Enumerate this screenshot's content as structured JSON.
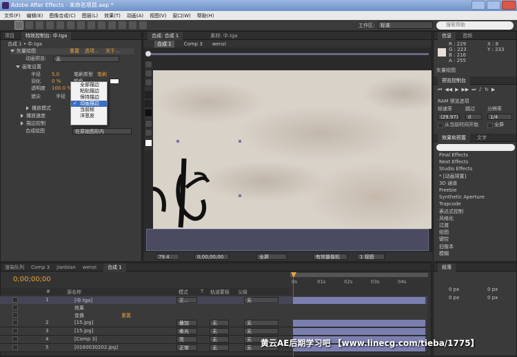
{
  "title": "Adobe After Effects - 未命名项目.aep *",
  "menu": [
    "文件(F)",
    "编辑(E)",
    "图像合成(C)",
    "图层(L)",
    "效果(T)",
    "动画(A)",
    "视图(V)",
    "窗口(W)",
    "帮助(H)"
  ],
  "workspace": {
    "label": "工作区:",
    "value": "标准"
  },
  "search_placeholder": "搜索帮助",
  "left_tabs": [
    "项目",
    "特效控制台: 中.tga"
  ],
  "comp_path": "合成 1 • 中.tga",
  "effect": {
    "name": "矢量绘图",
    "links": [
      "重置",
      "选项...",
      "关于..."
    ],
    "preview_label": "动画预览:",
    "preview_value": "无",
    "section": "画笔设置",
    "rows": [
      {
        "label": "半径",
        "value": "5.0",
        "extra_label": "笔刷类型",
        "extra_value": "笔刷"
      },
      {
        "label": "羽化",
        "value": "0 %",
        "extra_label": "颜色",
        "extra_value": ""
      },
      {
        "label": "透明度",
        "value": "100.0 %",
        "extra_label": "",
        "extra_value": ""
      },
      {
        "label": "遮尖",
        "value": "",
        "extra_label": "半径",
        "extra_value": ""
      }
    ],
    "items": [
      "播放模式",
      "播放速度",
      "描边控制",
      "合成绘图"
    ],
    "composite_value": "在原始图形内"
  },
  "popup": [
    "全部描边",
    "粘贴描边",
    "保持描边",
    "动画描边",
    "当前帧",
    "洋葱皮"
  ],
  "popup_selected": 3,
  "comp_tabs": [
    "合成: 合成 1",
    "素材: 中.tga"
  ],
  "breadcrumbs": [
    "合成 1",
    "Comp 3",
    "wenzi"
  ],
  "viewer_bar": {
    "zoom": "79.4",
    "time": "0;00;00;00",
    "res": "全屏",
    "camera": "有效摄像机",
    "views": "1 视图"
  },
  "info": {
    "tabs": [
      "信息",
      "音频"
    ],
    "R": "R : 229",
    "G": "G : 223",
    "B": "B : 216",
    "A": "A : 255",
    "X": "X : 8",
    "Y": "Y : 233",
    "footer": "矢量绘图"
  },
  "preview": {
    "tab": "预览控制台",
    "ram": "RAM 预览选项",
    "labels": [
      "帧速率",
      "跳过",
      "分辨率"
    ],
    "fps": "(29.97)",
    "skip": "0",
    "res": "1/4",
    "from_current": "从当前时间开始",
    "fullscreen": "全屏"
  },
  "effects_panel": {
    "tabs": [
      "效果和预置",
      "文字"
    ],
    "items": [
      "Final Effects",
      "Next Effects",
      "Studio Effects",
      "* [动画预置]",
      "3D 通道",
      "Freebie",
      "Synthetic Aperture",
      "Trapcode",
      "表达式控制",
      "风格化",
      "过渡",
      "绘图",
      "键控",
      "旧版本",
      "模糊"
    ]
  },
  "timeline": {
    "tabs": [
      "渲染队列",
      "Comp 3",
      "jianbian",
      "wenzi",
      "合成 1"
    ],
    "timecode": "0;00;00;00",
    "headers": [
      "#",
      "源名称",
      "模式",
      "T",
      "轨道蒙板",
      "父级"
    ],
    "ticks": [
      "0s",
      "01s",
      "02s",
      "03s",
      "04s"
    ],
    "layers": [
      {
        "num": "1",
        "name": "[中.tga]",
        "mode": "正...",
        "track": "",
        "parent": "无"
      },
      {
        "num": "",
        "name": "效果",
        "mode": "",
        "track": "",
        "parent": ""
      },
      {
        "num": "",
        "name": "变换",
        "mode": "",
        "track": "",
        "parent": "",
        "reset": "重置"
      },
      {
        "num": "2",
        "name": "[15.jpg]",
        "mode": "叠加",
        "track": "无",
        "parent": "无"
      },
      {
        "num": "3",
        "name": "[15.jpg]",
        "mode": "柔光",
        "track": "无",
        "parent": "无"
      },
      {
        "num": "4",
        "name": "[Comp 3]",
        "mode": "亮",
        "track": "无",
        "parent": "无"
      },
      {
        "num": "5",
        "name": "[0160030202.jpg]",
        "mode": "正常",
        "track": "无",
        "parent": "无"
      }
    ]
  },
  "paragraph_tab": "段落",
  "px_label": "0 px",
  "watermark": "黄云AE后期学习吧 【www.linecg.com/tieba/1775】"
}
